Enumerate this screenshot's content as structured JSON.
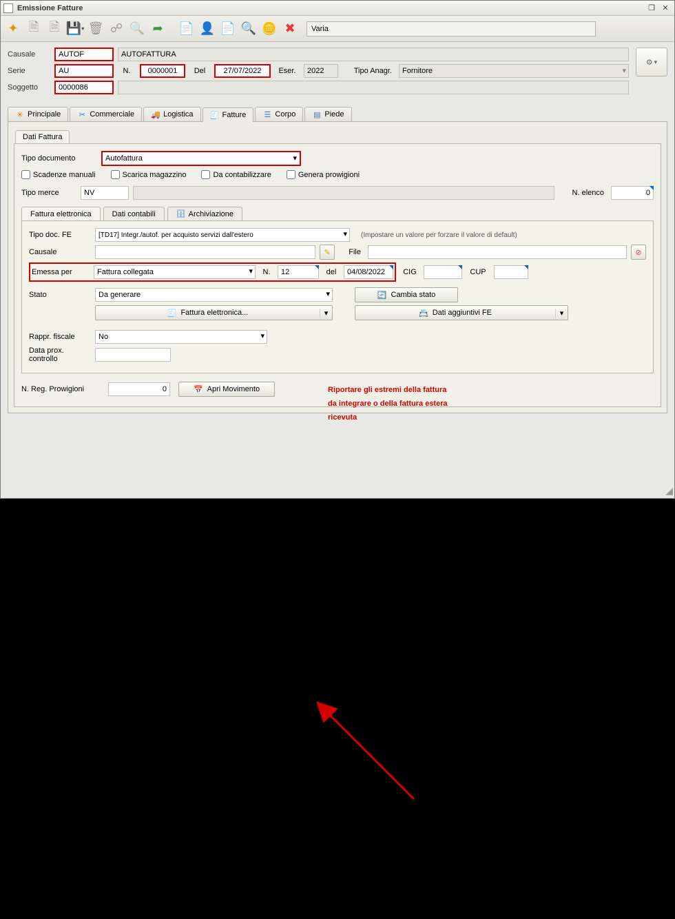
{
  "window": {
    "title": "Emissione Fatture"
  },
  "toolbar": {
    "varia": "Varia"
  },
  "header": {
    "causale_label": "Causale",
    "causale": "AUTOF",
    "causale_desc": "AUTOFATTURA",
    "serie_label": "Serie",
    "serie": "AU",
    "n_label": "N.",
    "numero": "0000001",
    "del_label": "Del",
    "del": "27/07/2022",
    "eser_label": "Eser.",
    "eser": "2022",
    "tipo_anagr_label": "Tipo Anagr.",
    "tipo_anagr": "Fornitore",
    "soggetto_label": "Soggetto",
    "soggetto": "0000086"
  },
  "tabs": {
    "principale": "Principale",
    "commerciale": "Commerciale",
    "logistica": "Logistica",
    "fatture": "Fatture",
    "corpo": "Corpo",
    "piede": "Piede",
    "dati_fattura": "Dati Fattura"
  },
  "doc": {
    "tipo_documento_label": "Tipo documento",
    "tipo_documento": "Autofattura",
    "scadenze_manuali": "Scadenze manuali",
    "scarica_magazzino": "Scarica magazzino",
    "da_contabilizzare": "Da contabilizzare",
    "genera_prowigioni": "Genera prowigioni",
    "tipo_merce_label": "Tipo merce",
    "tipo_merce": "NV",
    "n_elenco_label": "N. elenco",
    "n_elenco": "0"
  },
  "fe_tabs": {
    "fe": "Fattura elettronica",
    "dati_contabili": "Dati contabili",
    "archiviazione": "Archiviazione"
  },
  "fe": {
    "tipo_doc_fe_label": "Tipo doc. FE",
    "tipo_doc_fe": "[TD17] Integr./autof. per acquisto servizi dall'estero",
    "tipo_doc_fe_note": "(Impostare un valore per forzare il valore di default)",
    "causale_label": "Causale",
    "causale": "",
    "file_label": "File",
    "file": "",
    "emessa_per_label": "Emessa per",
    "emessa_per": "Fattura collegata",
    "n_label": "N.",
    "n": "12",
    "del_label": "del",
    "del": "04/08/2022",
    "cig_label": "CIG",
    "cig": "",
    "cup_label": "CUP",
    "cup": "",
    "stato_label": "Stato",
    "stato": "Da generare",
    "cambia_stato": "Cambia stato",
    "btn_fe": "Fattura elettronica...",
    "btn_dati_agg": "Dati aggiuntivi FE",
    "rappr_fiscale_label": "Rappr. fiscale",
    "rappr_fiscale": "No",
    "data_prox_label1": "Data prox.",
    "data_prox_label2": "controllo",
    "data_prox": ""
  },
  "footer": {
    "nreg_label": "N. Reg. Prowigioni",
    "nreg": "0",
    "apri_movimento": "Apri Movimento"
  },
  "annotation": {
    "line1": "Riportare gli estremi della fattura",
    "line2": "da integrare o della fattura estera",
    "line3": "ricevuta"
  }
}
